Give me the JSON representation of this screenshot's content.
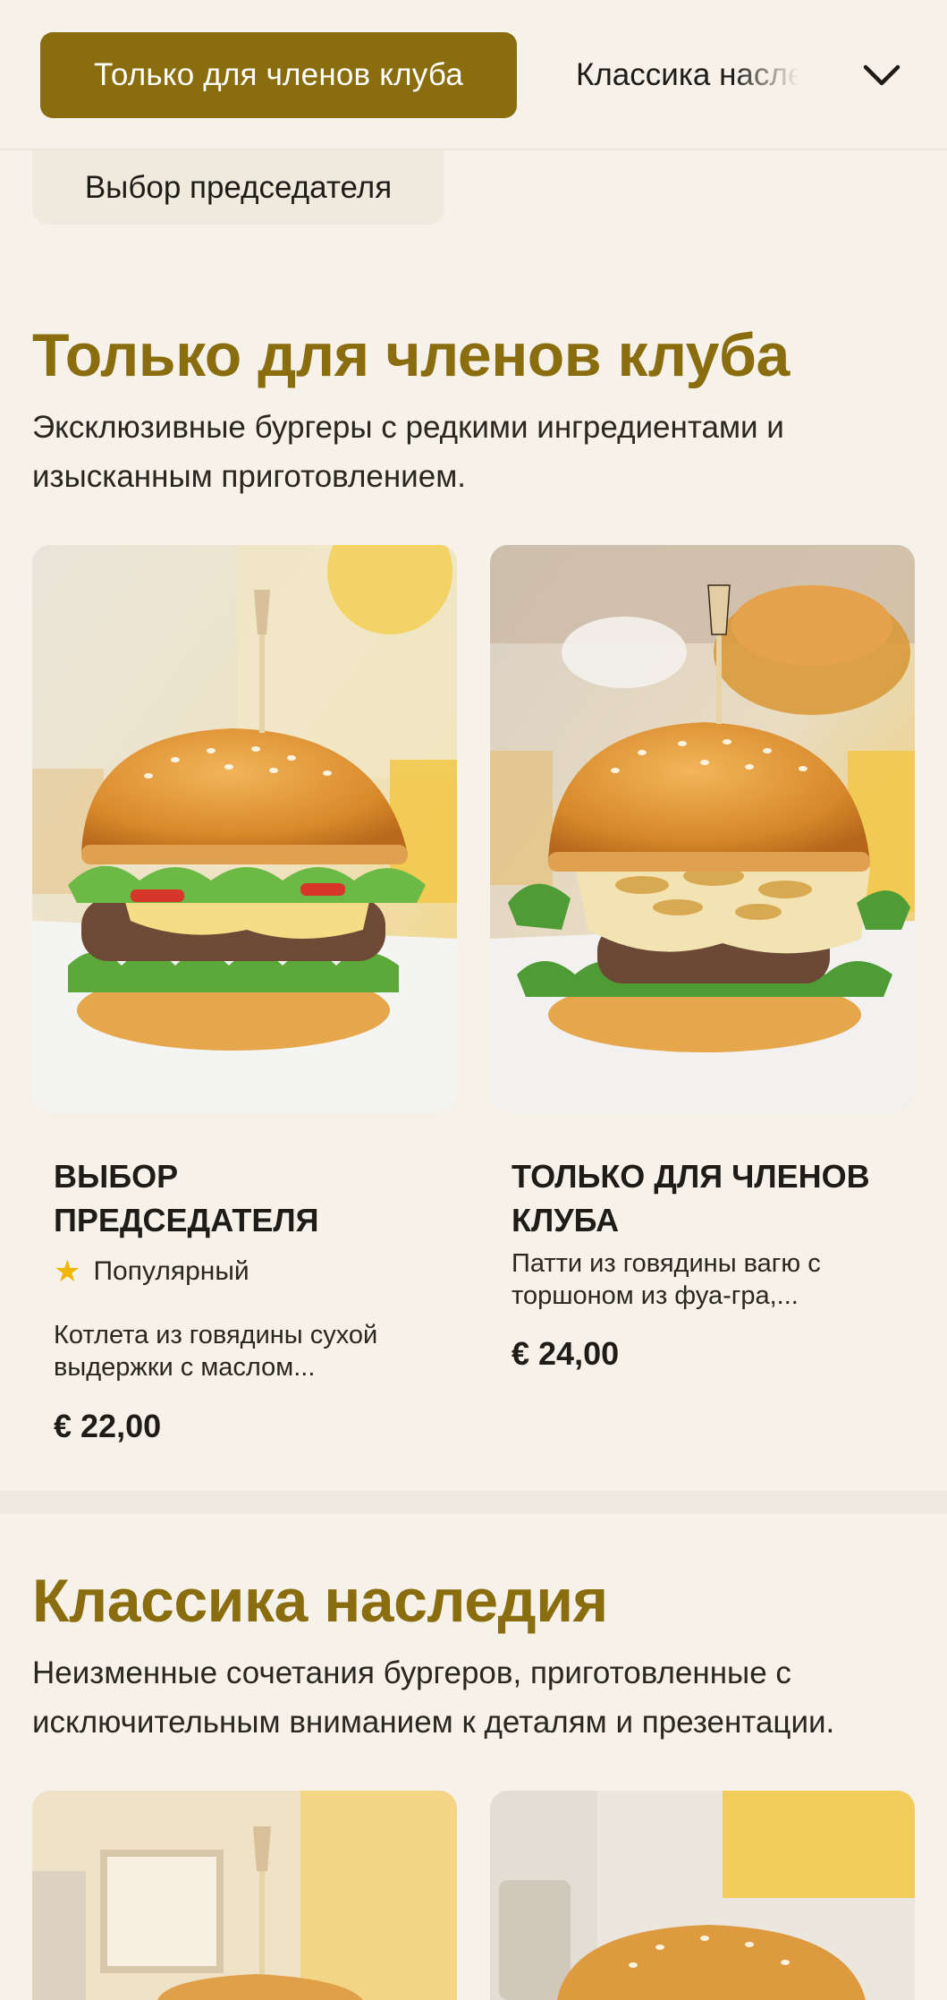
{
  "header": {
    "active_tab": "Только для членов клуба",
    "next_tab": "Классика наследия",
    "peek_chip": "Выбор председателя"
  },
  "sections": [
    {
      "title": "Только для членов клуба",
      "description": "Эксклюзивные бургеры с редкими ингредиентами и изысканным приготовлением.",
      "items": [
        {
          "name": "ВЫБОР ПРЕДСЕДАТЕЛЯ",
          "badge": "Популярный",
          "description": "Котлета из говядины сухой выдержки с маслом...",
          "price": "€ 22,00"
        },
        {
          "name": "ТОЛЬКО ДЛЯ ЧЛЕНОВ КЛУБА",
          "description": "Патти из говядины вагю с торшоном из фуа-гра,...",
          "price": "€ 24,00"
        }
      ]
    },
    {
      "title": "Классика наследия",
      "description": "Неизменные сочетания бургеров, приготовленные с исключительным вниманием к деталям и презентации."
    }
  ],
  "colors": {
    "accent": "#8a6d0f",
    "background": "#f6f2ea",
    "star": "#f2b705"
  },
  "icons": {
    "chevron": "chevron-down-icon",
    "star": "star-icon"
  }
}
